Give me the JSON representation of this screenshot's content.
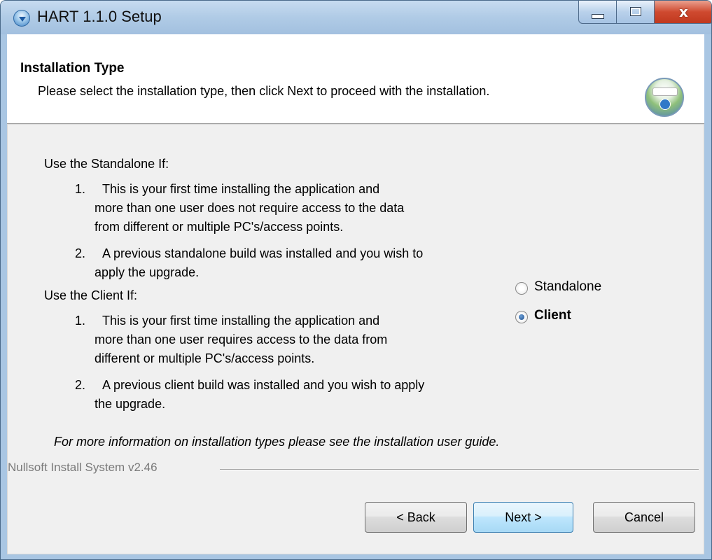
{
  "window": {
    "title": "HART 1.1.0 Setup",
    "close_glyph": "x"
  },
  "header": {
    "title": "Installation Type",
    "subtitle": "Please select the installation type, then click Next to proceed with the installation."
  },
  "content": {
    "standalone_heading": "Use the Standalone If:",
    "standalone_item1_num": "1.",
    "standalone_item1_lines": [
      "This is your first time installing the application and",
      "more than one user does not require access to the data",
      "from different or multiple PC's/access points."
    ],
    "standalone_item2_num": "2.",
    "standalone_item2_lines": [
      "A previous standalone build was installed and you wish to",
      "apply the upgrade."
    ],
    "client_heading": "Use the Client If:",
    "client_item1_num": "1.",
    "client_item1_lines": [
      "This is your first time installing the application and",
      "more than one user requires access to the data from",
      "different or multiple PC's/access points."
    ],
    "client_item2_num": "2.",
    "client_item2_lines": [
      "A previous client build was installed and you wish to apply",
      "the upgrade."
    ],
    "footnote": "For more information on installation types please see the installation user guide."
  },
  "options": {
    "selected": "Client",
    "standalone_label": "Standalone",
    "client_label": "Client"
  },
  "footer": {
    "branding": "Nullsoft Install System v2.46",
    "back_label": "< Back",
    "next_label": "Next >",
    "cancel_label": "Cancel"
  },
  "colors": {
    "title_bar": "#b0cbe6",
    "close_button": "#cf4a30",
    "body_background": "#f0f0f0",
    "default_button_border": "#3c7fb1"
  }
}
